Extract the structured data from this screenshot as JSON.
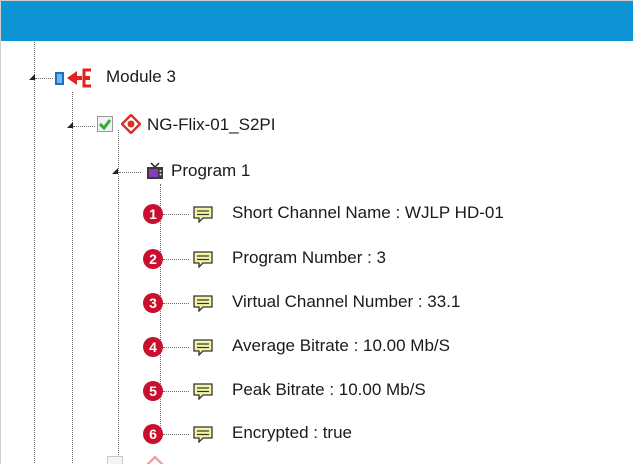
{
  "tree": {
    "module": {
      "label": "Module 3",
      "icon": "module-icon"
    },
    "transport": {
      "label": "NG-Flix-01_S2PI",
      "checked": true,
      "icon": "transport-icon"
    },
    "program": {
      "label": "Program 1",
      "icon": "tv-icon"
    },
    "properties": [
      {
        "badge": "1",
        "label": "Short Channel Name : WJLP HD-01",
        "icon": "property-icon"
      },
      {
        "badge": "2",
        "label": "Program Number : 3",
        "icon": "property-icon"
      },
      {
        "badge": "3",
        "label": "Virtual Channel Number : 33.1",
        "icon": "property-icon"
      },
      {
        "badge": "4",
        "label": "Average Bitrate : 10.00 Mb/S",
        "icon": "property-icon"
      },
      {
        "badge": "5",
        "label": "Peak Bitrate : 10.00 Mb/S",
        "icon": "property-icon"
      },
      {
        "badge": "6",
        "label": "Encrypted : true",
        "icon": "property-icon"
      }
    ]
  },
  "colors": {
    "titlebar": "#0e94d4",
    "badge": "#c8102e",
    "checkbox_check": "#3ca83c",
    "transport_icon": "#d9302c"
  }
}
